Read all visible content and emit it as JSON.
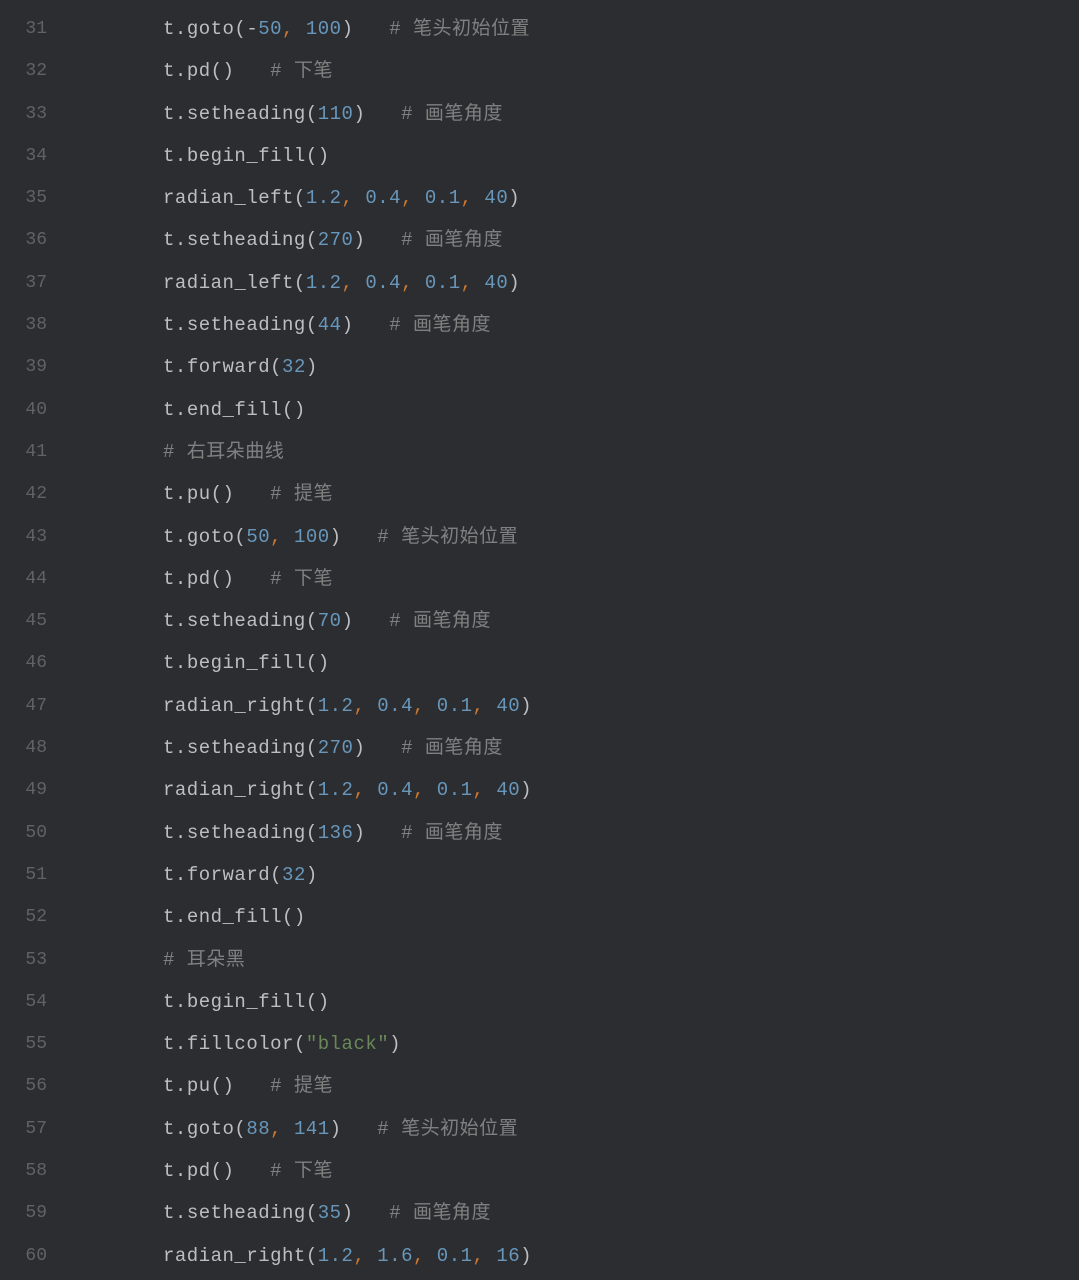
{
  "editor": {
    "startLine": 31,
    "lines": [
      {
        "n": 31,
        "tokens": [
          {
            "t": "ind",
            "v": "    "
          },
          {
            "t": "id",
            "v": "t"
          },
          {
            "t": "p",
            "v": "."
          },
          {
            "t": "id",
            "v": "goto"
          },
          {
            "t": "p",
            "v": "("
          },
          {
            "t": "op",
            "v": "-"
          },
          {
            "t": "num",
            "v": "50"
          },
          {
            "t": "comma",
            "v": ", "
          },
          {
            "t": "num",
            "v": "100"
          },
          {
            "t": "p",
            "v": ")"
          },
          {
            "t": "sp",
            "v": "   "
          },
          {
            "t": "cmt",
            "v": "# 笔头初始位置"
          }
        ]
      },
      {
        "n": 32,
        "tokens": [
          {
            "t": "ind",
            "v": "    "
          },
          {
            "t": "id",
            "v": "t"
          },
          {
            "t": "p",
            "v": "."
          },
          {
            "t": "id",
            "v": "pd"
          },
          {
            "t": "p",
            "v": "()"
          },
          {
            "t": "sp",
            "v": "   "
          },
          {
            "t": "cmt",
            "v": "# 下笔"
          }
        ]
      },
      {
        "n": 33,
        "tokens": [
          {
            "t": "ind",
            "v": "    "
          },
          {
            "t": "id",
            "v": "t"
          },
          {
            "t": "p",
            "v": "."
          },
          {
            "t": "id",
            "v": "setheading"
          },
          {
            "t": "p",
            "v": "("
          },
          {
            "t": "num",
            "v": "110"
          },
          {
            "t": "p",
            "v": ")"
          },
          {
            "t": "sp",
            "v": "   "
          },
          {
            "t": "cmt",
            "v": "# 画笔角度"
          }
        ]
      },
      {
        "n": 34,
        "tokens": [
          {
            "t": "ind",
            "v": "    "
          },
          {
            "t": "id",
            "v": "t"
          },
          {
            "t": "p",
            "v": "."
          },
          {
            "t": "id",
            "v": "begin_fill"
          },
          {
            "t": "p",
            "v": "()"
          }
        ]
      },
      {
        "n": 35,
        "tokens": [
          {
            "t": "ind",
            "v": "    "
          },
          {
            "t": "id",
            "v": "radian_left"
          },
          {
            "t": "p",
            "v": "("
          },
          {
            "t": "num",
            "v": "1.2"
          },
          {
            "t": "comma",
            "v": ", "
          },
          {
            "t": "num",
            "v": "0.4"
          },
          {
            "t": "comma",
            "v": ", "
          },
          {
            "t": "num",
            "v": "0.1"
          },
          {
            "t": "comma",
            "v": ", "
          },
          {
            "t": "num",
            "v": "40"
          },
          {
            "t": "p",
            "v": ")"
          }
        ]
      },
      {
        "n": 36,
        "tokens": [
          {
            "t": "ind",
            "v": "    "
          },
          {
            "t": "id",
            "v": "t"
          },
          {
            "t": "p",
            "v": "."
          },
          {
            "t": "id",
            "v": "setheading"
          },
          {
            "t": "p",
            "v": "("
          },
          {
            "t": "num",
            "v": "270"
          },
          {
            "t": "p",
            "v": ")"
          },
          {
            "t": "sp",
            "v": "   "
          },
          {
            "t": "cmt",
            "v": "# 画笔角度"
          }
        ]
      },
      {
        "n": 37,
        "tokens": [
          {
            "t": "ind",
            "v": "    "
          },
          {
            "t": "id",
            "v": "radian_left"
          },
          {
            "t": "p",
            "v": "("
          },
          {
            "t": "num",
            "v": "1.2"
          },
          {
            "t": "comma",
            "v": ", "
          },
          {
            "t": "num",
            "v": "0.4"
          },
          {
            "t": "comma",
            "v": ", "
          },
          {
            "t": "num",
            "v": "0.1"
          },
          {
            "t": "comma",
            "v": ", "
          },
          {
            "t": "num",
            "v": "40"
          },
          {
            "t": "p",
            "v": ")"
          }
        ]
      },
      {
        "n": 38,
        "tokens": [
          {
            "t": "ind",
            "v": "    "
          },
          {
            "t": "id",
            "v": "t"
          },
          {
            "t": "p",
            "v": "."
          },
          {
            "t": "id",
            "v": "setheading"
          },
          {
            "t": "p",
            "v": "("
          },
          {
            "t": "num",
            "v": "44"
          },
          {
            "t": "p",
            "v": ")"
          },
          {
            "t": "sp",
            "v": "   "
          },
          {
            "t": "cmt",
            "v": "# 画笔角度"
          }
        ]
      },
      {
        "n": 39,
        "tokens": [
          {
            "t": "ind",
            "v": "    "
          },
          {
            "t": "id",
            "v": "t"
          },
          {
            "t": "p",
            "v": "."
          },
          {
            "t": "id",
            "v": "forward"
          },
          {
            "t": "p",
            "v": "("
          },
          {
            "t": "num",
            "v": "32"
          },
          {
            "t": "p",
            "v": ")"
          }
        ]
      },
      {
        "n": 40,
        "tokens": [
          {
            "t": "ind",
            "v": "    "
          },
          {
            "t": "id",
            "v": "t"
          },
          {
            "t": "p",
            "v": "."
          },
          {
            "t": "id",
            "v": "end_fill"
          },
          {
            "t": "p",
            "v": "()"
          }
        ]
      },
      {
        "n": 41,
        "tokens": [
          {
            "t": "ind",
            "v": "    "
          },
          {
            "t": "cmt",
            "v": "# 右耳朵曲线"
          }
        ]
      },
      {
        "n": 42,
        "tokens": [
          {
            "t": "ind",
            "v": "    "
          },
          {
            "t": "id",
            "v": "t"
          },
          {
            "t": "p",
            "v": "."
          },
          {
            "t": "id",
            "v": "pu"
          },
          {
            "t": "p",
            "v": "()"
          },
          {
            "t": "sp",
            "v": "   "
          },
          {
            "t": "cmt",
            "v": "# 提笔"
          }
        ]
      },
      {
        "n": 43,
        "tokens": [
          {
            "t": "ind",
            "v": "    "
          },
          {
            "t": "id",
            "v": "t"
          },
          {
            "t": "p",
            "v": "."
          },
          {
            "t": "id",
            "v": "goto"
          },
          {
            "t": "p",
            "v": "("
          },
          {
            "t": "num",
            "v": "50"
          },
          {
            "t": "comma",
            "v": ", "
          },
          {
            "t": "num",
            "v": "100"
          },
          {
            "t": "p",
            "v": ")"
          },
          {
            "t": "sp",
            "v": "   "
          },
          {
            "t": "cmt",
            "v": "# 笔头初始位置"
          }
        ]
      },
      {
        "n": 44,
        "tokens": [
          {
            "t": "ind",
            "v": "    "
          },
          {
            "t": "id",
            "v": "t"
          },
          {
            "t": "p",
            "v": "."
          },
          {
            "t": "id",
            "v": "pd"
          },
          {
            "t": "p",
            "v": "()"
          },
          {
            "t": "sp",
            "v": "   "
          },
          {
            "t": "cmt",
            "v": "# 下笔"
          }
        ]
      },
      {
        "n": 45,
        "tokens": [
          {
            "t": "ind",
            "v": "    "
          },
          {
            "t": "id",
            "v": "t"
          },
          {
            "t": "p",
            "v": "."
          },
          {
            "t": "id",
            "v": "setheading"
          },
          {
            "t": "p",
            "v": "("
          },
          {
            "t": "num",
            "v": "70"
          },
          {
            "t": "p",
            "v": ")"
          },
          {
            "t": "sp",
            "v": "   "
          },
          {
            "t": "cmt",
            "v": "# 画笔角度"
          }
        ]
      },
      {
        "n": 46,
        "tokens": [
          {
            "t": "ind",
            "v": "    "
          },
          {
            "t": "id",
            "v": "t"
          },
          {
            "t": "p",
            "v": "."
          },
          {
            "t": "id",
            "v": "begin_fill"
          },
          {
            "t": "p",
            "v": "()"
          }
        ]
      },
      {
        "n": 47,
        "tokens": [
          {
            "t": "ind",
            "v": "    "
          },
          {
            "t": "id",
            "v": "radian_right"
          },
          {
            "t": "p",
            "v": "("
          },
          {
            "t": "num",
            "v": "1.2"
          },
          {
            "t": "comma",
            "v": ", "
          },
          {
            "t": "num",
            "v": "0.4"
          },
          {
            "t": "comma",
            "v": ", "
          },
          {
            "t": "num",
            "v": "0.1"
          },
          {
            "t": "comma",
            "v": ", "
          },
          {
            "t": "num",
            "v": "40"
          },
          {
            "t": "p",
            "v": ")"
          }
        ]
      },
      {
        "n": 48,
        "tokens": [
          {
            "t": "ind",
            "v": "    "
          },
          {
            "t": "id",
            "v": "t"
          },
          {
            "t": "p",
            "v": "."
          },
          {
            "t": "id",
            "v": "setheading"
          },
          {
            "t": "p",
            "v": "("
          },
          {
            "t": "num",
            "v": "270"
          },
          {
            "t": "p",
            "v": ")"
          },
          {
            "t": "sp",
            "v": "   "
          },
          {
            "t": "cmt",
            "v": "# 画笔角度"
          }
        ]
      },
      {
        "n": 49,
        "tokens": [
          {
            "t": "ind",
            "v": "    "
          },
          {
            "t": "id",
            "v": "radian_right"
          },
          {
            "t": "p",
            "v": "("
          },
          {
            "t": "num",
            "v": "1.2"
          },
          {
            "t": "comma",
            "v": ", "
          },
          {
            "t": "num",
            "v": "0.4"
          },
          {
            "t": "comma",
            "v": ", "
          },
          {
            "t": "num",
            "v": "0.1"
          },
          {
            "t": "comma",
            "v": ", "
          },
          {
            "t": "num",
            "v": "40"
          },
          {
            "t": "p",
            "v": ")"
          }
        ]
      },
      {
        "n": 50,
        "tokens": [
          {
            "t": "ind",
            "v": "    "
          },
          {
            "t": "id",
            "v": "t"
          },
          {
            "t": "p",
            "v": "."
          },
          {
            "t": "id",
            "v": "setheading"
          },
          {
            "t": "p",
            "v": "("
          },
          {
            "t": "num",
            "v": "136"
          },
          {
            "t": "p",
            "v": ")"
          },
          {
            "t": "sp",
            "v": "   "
          },
          {
            "t": "cmt",
            "v": "# 画笔角度"
          }
        ]
      },
      {
        "n": 51,
        "tokens": [
          {
            "t": "ind",
            "v": "    "
          },
          {
            "t": "id",
            "v": "t"
          },
          {
            "t": "p",
            "v": "."
          },
          {
            "t": "id",
            "v": "forward"
          },
          {
            "t": "p",
            "v": "("
          },
          {
            "t": "num",
            "v": "32"
          },
          {
            "t": "p",
            "v": ")"
          }
        ]
      },
      {
        "n": 52,
        "tokens": [
          {
            "t": "ind",
            "v": "    "
          },
          {
            "t": "id",
            "v": "t"
          },
          {
            "t": "p",
            "v": "."
          },
          {
            "t": "id",
            "v": "end_fill"
          },
          {
            "t": "p",
            "v": "()"
          }
        ]
      },
      {
        "n": 53,
        "tokens": [
          {
            "t": "ind",
            "v": "    "
          },
          {
            "t": "cmt",
            "v": "# 耳朵黑"
          }
        ]
      },
      {
        "n": 54,
        "tokens": [
          {
            "t": "ind",
            "v": "    "
          },
          {
            "t": "id",
            "v": "t"
          },
          {
            "t": "p",
            "v": "."
          },
          {
            "t": "id",
            "v": "begin_fill"
          },
          {
            "t": "p",
            "v": "()"
          }
        ]
      },
      {
        "n": 55,
        "tokens": [
          {
            "t": "ind",
            "v": "    "
          },
          {
            "t": "id",
            "v": "t"
          },
          {
            "t": "p",
            "v": "."
          },
          {
            "t": "id",
            "v": "fillcolor"
          },
          {
            "t": "p",
            "v": "("
          },
          {
            "t": "str",
            "v": "\"black\""
          },
          {
            "t": "p",
            "v": ")"
          }
        ]
      },
      {
        "n": 56,
        "tokens": [
          {
            "t": "ind",
            "v": "    "
          },
          {
            "t": "id",
            "v": "t"
          },
          {
            "t": "p",
            "v": "."
          },
          {
            "t": "id",
            "v": "pu"
          },
          {
            "t": "p",
            "v": "()"
          },
          {
            "t": "sp",
            "v": "   "
          },
          {
            "t": "cmt",
            "v": "# 提笔"
          }
        ]
      },
      {
        "n": 57,
        "tokens": [
          {
            "t": "ind",
            "v": "    "
          },
          {
            "t": "id",
            "v": "t"
          },
          {
            "t": "p",
            "v": "."
          },
          {
            "t": "id",
            "v": "goto"
          },
          {
            "t": "p",
            "v": "("
          },
          {
            "t": "num",
            "v": "88"
          },
          {
            "t": "comma",
            "v": ", "
          },
          {
            "t": "num",
            "v": "141"
          },
          {
            "t": "p",
            "v": ")"
          },
          {
            "t": "sp",
            "v": "   "
          },
          {
            "t": "cmt",
            "v": "# 笔头初始位置"
          }
        ]
      },
      {
        "n": 58,
        "tokens": [
          {
            "t": "ind",
            "v": "    "
          },
          {
            "t": "id",
            "v": "t"
          },
          {
            "t": "p",
            "v": "."
          },
          {
            "t": "id",
            "v": "pd"
          },
          {
            "t": "p",
            "v": "()"
          },
          {
            "t": "sp",
            "v": "   "
          },
          {
            "t": "cmt",
            "v": "# 下笔"
          }
        ]
      },
      {
        "n": 59,
        "tokens": [
          {
            "t": "ind",
            "v": "    "
          },
          {
            "t": "id",
            "v": "t"
          },
          {
            "t": "p",
            "v": "."
          },
          {
            "t": "id",
            "v": "setheading"
          },
          {
            "t": "p",
            "v": "("
          },
          {
            "t": "num",
            "v": "35"
          },
          {
            "t": "p",
            "v": ")"
          },
          {
            "t": "sp",
            "v": "   "
          },
          {
            "t": "cmt",
            "v": "# 画笔角度"
          }
        ]
      },
      {
        "n": 60,
        "tokens": [
          {
            "t": "ind",
            "v": "    "
          },
          {
            "t": "id",
            "v": "radian_right"
          },
          {
            "t": "p",
            "v": "("
          },
          {
            "t": "num",
            "v": "1.2"
          },
          {
            "t": "comma",
            "v": ", "
          },
          {
            "t": "num",
            "v": "1.6"
          },
          {
            "t": "comma",
            "v": ", "
          },
          {
            "t": "num",
            "v": "0.1"
          },
          {
            "t": "comma",
            "v": ", "
          },
          {
            "t": "num",
            "v": "16"
          },
          {
            "t": "p",
            "v": ")"
          }
        ]
      }
    ]
  },
  "colors": {
    "background": "#2b2d30",
    "gutter": "#606366",
    "default": "#bcbec4",
    "number": "#6897bb",
    "string": "#6a8759",
    "comment": "#808080",
    "comma": "#cc7832"
  }
}
